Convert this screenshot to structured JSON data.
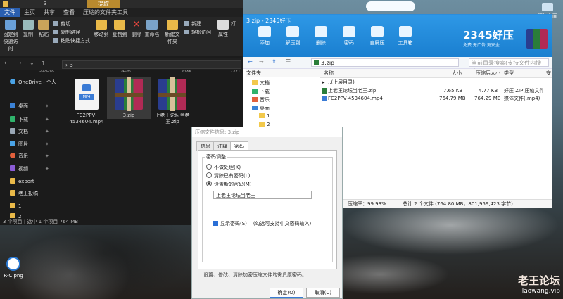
{
  "explorer": {
    "tabs": [
      "文件",
      "主页",
      "共享",
      "查看",
      "压缩的文件夹工具"
    ],
    "context_tab": "提取",
    "ribbon": {
      "pin_label": "固定到快速访问",
      "copy_label": "复制",
      "paste_label": "粘贴",
      "cut_label": "剪切",
      "copy_path_label": "复制路径",
      "paste_shortcut_label": "粘贴快捷方式",
      "move_to_label": "移动到",
      "copy_to_label": "复制到",
      "delete_label": "删除",
      "rename_label": "重命名",
      "new_folder_label": "新建文件夹",
      "new_item_label": "新建",
      "easy_access_label": "轻松访问",
      "properties_label": "属性",
      "open_label": "打",
      "group_clipboard": "剪贴板",
      "group_organize": "组织",
      "group_new": "新建",
      "group_open": "打开"
    },
    "address": "3",
    "nav": [
      {
        "label": "OneDrive - 个人"
      },
      {
        "label": "桌面"
      },
      {
        "label": "下载"
      },
      {
        "label": "文档"
      },
      {
        "label": "图片"
      },
      {
        "label": "音乐"
      },
      {
        "label": "视频"
      },
      {
        "label": "export"
      },
      {
        "label": "老王投稿"
      },
      {
        "label": "1"
      },
      {
        "label": "2"
      }
    ],
    "files": [
      {
        "name": "FC2PPV-4534604.mp4",
        "kind": "mp4",
        "badge": "MP4"
      },
      {
        "name": "3.zip",
        "kind": "zip"
      },
      {
        "name": "上老王论坛当老王.zip",
        "kind": "zip"
      }
    ],
    "status": "3 个项目  |  选中 1 个项目 764 MB"
  },
  "topbar": {
    "pill": "",
    "right_icon_label": "添加台面"
  },
  "zip": {
    "title": "3.zip - 2345好压",
    "brand": "2345好压",
    "brand_slogan": "免费 无广告 更安全",
    "toolbar": [
      "添加",
      "解压到",
      "删除",
      "密码",
      "自解压",
      "工具箱"
    ],
    "address": "3.zip",
    "search_placeholder": "当前目录搜索(支持文件内搜索)",
    "tree_header": "文件夹",
    "tree": [
      "文档",
      "下载",
      "音乐",
      "桌面",
      "1",
      "2",
      "3"
    ],
    "columns": [
      "名称",
      "大小",
      "压缩后大小",
      "类型",
      "安"
    ],
    "rows": [
      {
        "name": "..(上层目录)",
        "size": "",
        "packed": "",
        "type": ""
      },
      {
        "name": "上老王论坛当老王.zip",
        "size": "7.65 KB",
        "packed": "4.77 KB",
        "type": "好压 ZIP 压缩文件"
      },
      {
        "name": "FC2PPV-4534604.mp4",
        "size": "764.79 MB",
        "packed": "764.29 MB",
        "type": "媒体文件(.mp4)"
      }
    ],
    "status_left": "压缩率：99.93%",
    "status_right": "总计 2 个文件 (764.80 MB，801,959,423 字节)"
  },
  "dialog": {
    "title": "压缩文件信息: 3.zip",
    "tabs": [
      "信息",
      "注释",
      "密码"
    ],
    "group_title": "密码调整",
    "options": [
      "不做处理(K)",
      "清除已有密码(L)",
      "设置新的密码(M)"
    ],
    "password_value": "上老王论坛当老王",
    "show_password": "显示密码(S)",
    "show_password_hint": "(勾选可支持中文密码输入)",
    "note": "设置、修改、清除加密压缩文件均需具原密码。",
    "ok_label": "确定(O)",
    "cancel_label": "取消(C)"
  },
  "desktop": {
    "icon_label": "R-C.png"
  },
  "watermark": {
    "line1": "老王论坛",
    "line2": "laowang.vip"
  },
  "colors": {
    "zip_header": "#1a7fd0",
    "explorer_bg": "#1b1b1b",
    "file_tab": "#2a5fb0",
    "context_tab": "#b98a2e"
  }
}
